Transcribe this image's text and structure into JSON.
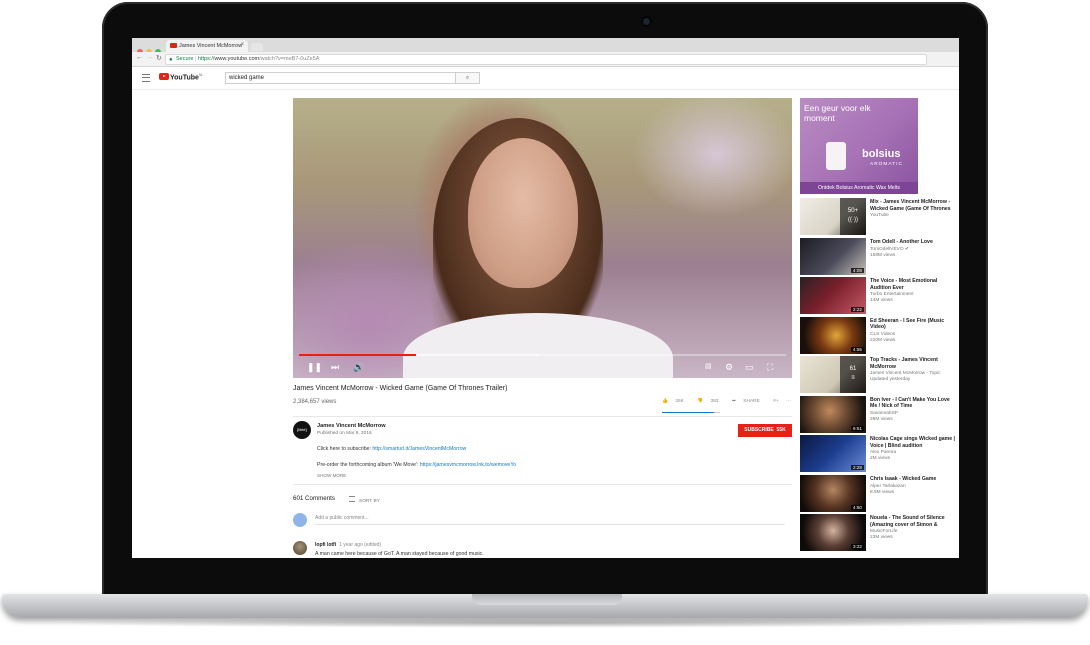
{
  "browser": {
    "tab_title": "James Vincent McMorrow",
    "tab_close": "×",
    "secure_label": "Secure",
    "url_scheme": "https://",
    "url_host": "www.youtube.com",
    "url_path": "/watch?v=meB7-0uZe5A"
  },
  "header": {
    "logo": "YouTube",
    "logo_region": "NL",
    "search_value": "wicked game",
    "search_button": "⌕"
  },
  "video": {
    "title": "James Vincent McMorrow - Wicked Game (Game Of Thrones Trailer)",
    "views": "2,384,657 views",
    "progress_played": 0.24,
    "progress_loaded": 0.49,
    "likes": "26K",
    "dislikes": "383",
    "share_label": "SHARE",
    "like_ratio": 0.9
  },
  "channel": {
    "name": "James Vincent McMorrow",
    "avatar_text": "{litéé}",
    "published": "Published on Mar 9, 2016",
    "subscribe_label": "SUBSCRIBE",
    "subscriber_count": "55K"
  },
  "description": {
    "line1_text": "Click here to subscribe: ",
    "line1_link": "http://smarturl.it/JamesVincentMcMorrow",
    "line2_text": "Pre-order the forthcoming album 'We Move': ",
    "line2_link": "https://jamesvmcmorrow.lnk.to/wemoveYo",
    "show_more": "SHOW MORE"
  },
  "comments": {
    "count": "601 Comments",
    "sort_label": "SORT BY",
    "add_placeholder": "Add a public comment...",
    "first_author": "lopfi lotfi",
    "first_time": "1 year ago (edited)",
    "first_text": "A man came here because of GoT. A man stayed because of good music."
  },
  "ad": {
    "headline": "Een geur voor elk moment",
    "brand": "bolsius",
    "sub": "AROMATIC",
    "footer": "Ontdek Bolsius Aromatic Wax Melts"
  },
  "related": [
    {
      "title": "Mix - James Vincent McMorrow - Wicked Game (Game Of Thrones",
      "meta1": "YouTube",
      "meta2": "",
      "duration": "",
      "mix": "50+",
      "mix_sub": "((·))"
    },
    {
      "title": "Tom Odell - Another Love",
      "meta1": "TomOdellVEVO ✔",
      "meta2": "158M views",
      "duration": "4:08"
    },
    {
      "title": "The Voice - Most Emotional Audition Ever",
      "meta1": "Turbo Entertainment",
      "meta2": "14M views",
      "duration": "2:22"
    },
    {
      "title": "Ed Sheeran - I See Fire (Music Video)",
      "meta1": "CLS Videos",
      "meta2": "220M views",
      "duration": "4:55"
    },
    {
      "title": "Top Tracks - James Vincent McMorrow",
      "meta1": "James Vincent McMorrow - Topic",
      "meta2": "Updated yesterday",
      "duration": "",
      "mix": "61",
      "mix_sub": "≡"
    },
    {
      "title": "Bon Iver - I Can't Make You Love Me / Nick of Time",
      "meta1": "SavannahSP",
      "meta2": "28M views",
      "duration": "6:51"
    },
    {
      "title": "Nicolas Cage sings Wicked game | Voice | Blind audition",
      "meta1": "Alex Pareira",
      "meta2": "2M views",
      "duration": "2:28"
    },
    {
      "title": "Chris Isaak - Wicked Game",
      "meta1": "Alper Tarlakazan",
      "meta2": "8.9M views",
      "duration": "4:50"
    },
    {
      "title": "Nouela - The Sound of Silence (Amazing cover of Simon &",
      "meta1": "MusicForLife",
      "meta2": "23M views",
      "duration": "3:22"
    }
  ],
  "colors": {
    "youtube_red": "#e62117",
    "link_blue": "#167ac6",
    "ad_purple": "#a671b5"
  }
}
